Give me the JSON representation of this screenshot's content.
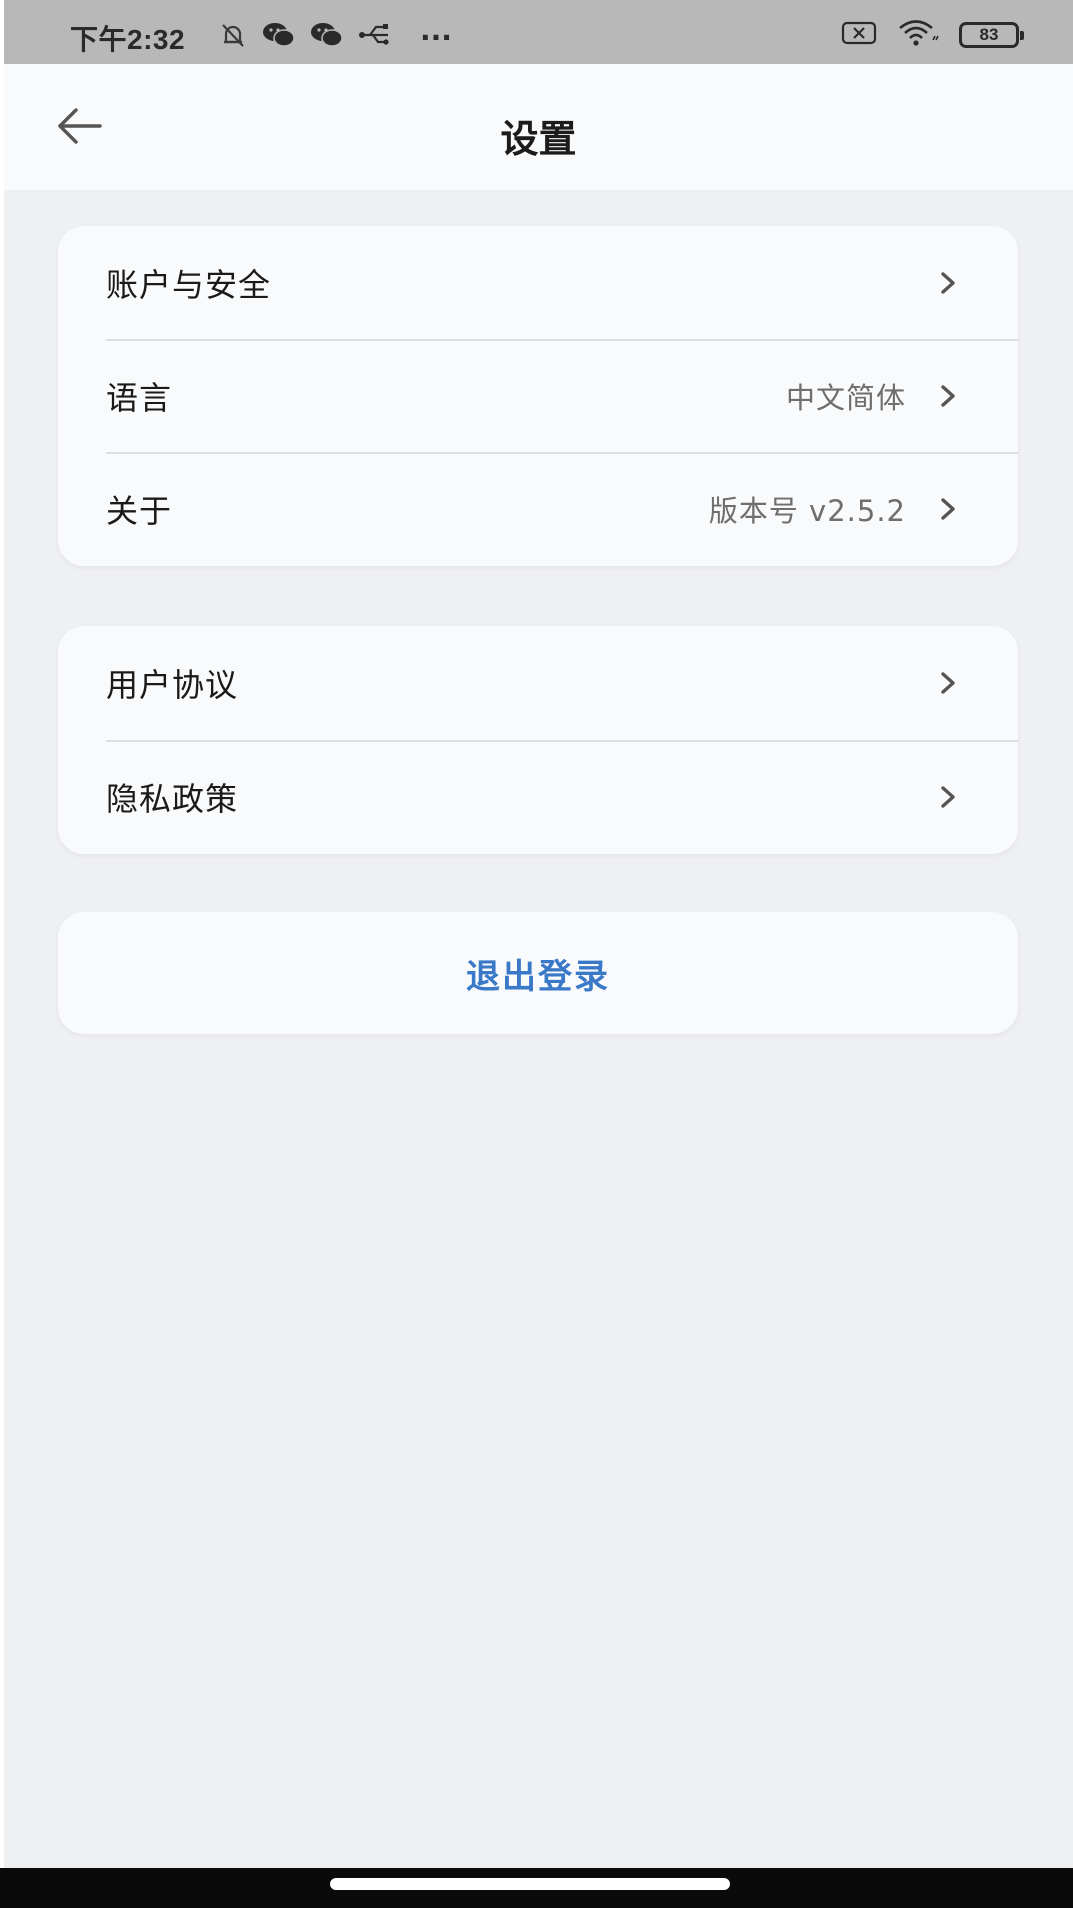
{
  "status_bar": {
    "time": "下午2:32",
    "battery": "83",
    "more": "···",
    "icons": [
      "bell-off-icon",
      "wechat-icon",
      "wechat-icon",
      "usb-icon",
      "sim-off-icon",
      "wifi-icon",
      "battery-icon"
    ]
  },
  "header": {
    "title": "设置",
    "back_icon": "arrow-left-icon"
  },
  "group_1": {
    "items": [
      {
        "label": "账户与安全",
        "value": ""
      },
      {
        "label": "语言",
        "value": "中文简体"
      },
      {
        "label": "关于",
        "value": "版本号 v2.5.2"
      }
    ]
  },
  "group_2": {
    "items": [
      {
        "label": "用户协议",
        "value": ""
      },
      {
        "label": "隐私政策",
        "value": ""
      }
    ]
  },
  "logout": {
    "label": "退出登录"
  },
  "colors": {
    "background": "#eff0f2",
    "card": "#f9fafb",
    "accent": "#3a78c8",
    "status_bar": "#b8b8b8"
  }
}
